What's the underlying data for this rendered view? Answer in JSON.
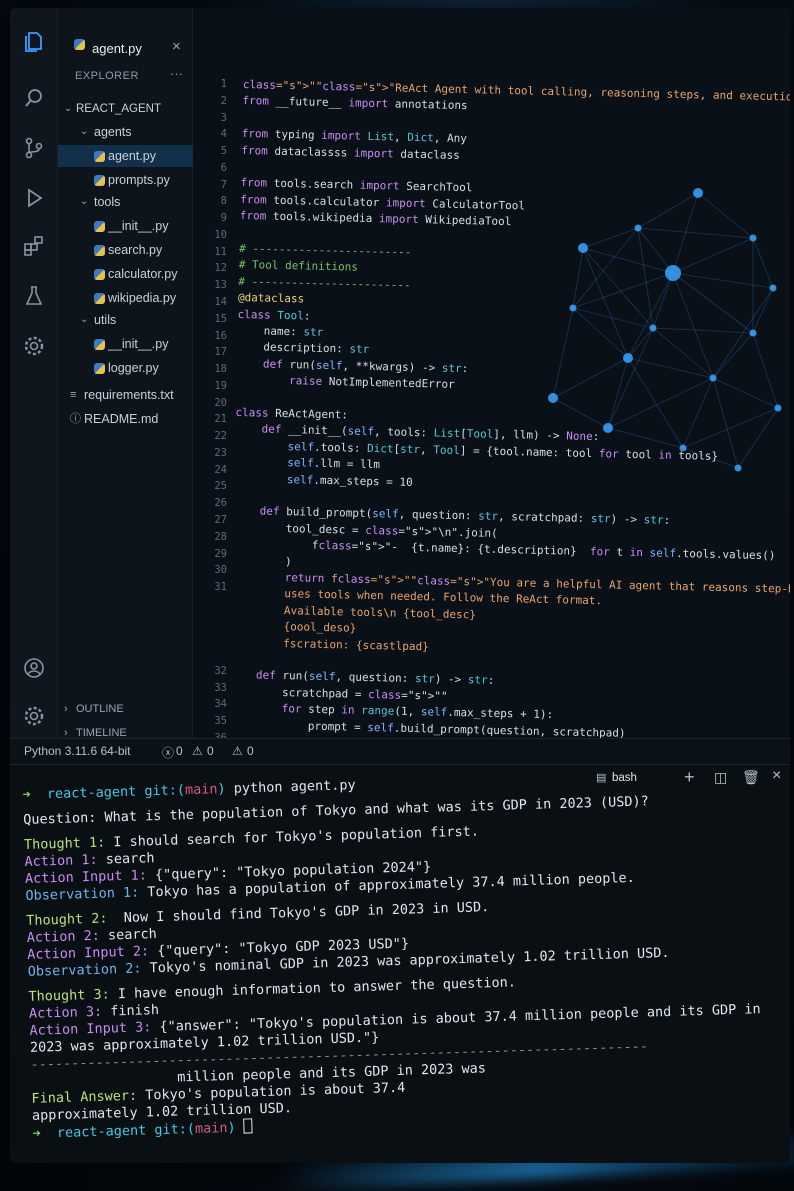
{
  "editor_tab": {
    "filename": "agent.py",
    "close_glyph": "×"
  },
  "explorer": {
    "title": "EXPLORER",
    "more": "···",
    "root": "REACT_AGENT",
    "items": [
      {
        "label": "agents",
        "type": "folder"
      },
      {
        "label": "agent.py",
        "type": "py",
        "selected": true
      },
      {
        "label": "prompts.py",
        "type": "py"
      },
      {
        "label": "tools",
        "type": "folder"
      },
      {
        "label": "__init__.py",
        "type": "py"
      },
      {
        "label": "search.py",
        "type": "py"
      },
      {
        "label": "calculator.py",
        "type": "py"
      },
      {
        "label": "wikipedia.py",
        "type": "py"
      },
      {
        "label": "utils",
        "type": "folder"
      },
      {
        "label": "__init__.py",
        "type": "py"
      },
      {
        "label": "logger.py",
        "type": "py"
      },
      {
        "label": "requirements.txt",
        "type": "txt"
      },
      {
        "label": "README.md",
        "type": "md"
      }
    ],
    "outline": "OUTLINE",
    "timeline": "TIMELINE"
  },
  "activity_icons": [
    "files-icon",
    "search-icon",
    "source-control-icon",
    "run-debug-icon",
    "extensions-icon",
    "testing-icon",
    "settings-gear-icon",
    "account-icon",
    "manage-gear-icon"
  ],
  "code": {
    "line_numbers": [
      "1",
      "2",
      "3",
      "4",
      "5",
      "6",
      "7",
      "8",
      "9",
      "10",
      "11",
      "12",
      "13",
      "14",
      "15",
      "16",
      "17",
      "18",
      "19",
      "20",
      "21",
      "22",
      "23",
      "24",
      "25",
      "26",
      "27",
      "28",
      "29",
      "30",
      "31",
      "32",
      "33",
      "34",
      "35",
      "36"
    ],
    "lines": [
      "\"\"\"ReAct Agent with tool calling, reasoning steps, and execution loop.\"\"\"",
      "from __future__ import annotations",
      "",
      "from typing import List, Dict, Any",
      "from dataclassss import dataclass",
      "",
      "from tools.search import SearchTool",
      "from tools.calculator import CalculatorTool",
      "from tools.wikipedia import WikipediaTool",
      "",
      "# ------------------------",
      "# Tool definitions",
      "# ------------------------",
      "@dataclass",
      "class Tool:",
      "    name: str",
      "    description: str",
      "    def run(self, **kwargs) -> str:",
      "        raise NotImplementedError",
      "",
      "class ReActAgent:",
      "    def __init__(self, tools: List[Tool], llm) -> None:",
      "        self.tools: Dict[str, Tool] = {tool.name: tool for tool in tools}",
      "        self.llm = llm",
      "        self.max_steps = 10",
      "",
      "    def build_prompt(self, question: str, scratchpad: str) -> str:",
      "        tool_desc = \"\\n\".join(",
      "            f\"-  {t.name}: {t.description}  for t in self.tools.values()",
      "        )",
      "        return f\"\"\"You are a helpful AI agent that reasons step-by-step and",
      "        uses tools when needed. Follow the ReAct format.",
      "        Available tools\\n {tool_desc}",
      "        {oool_deso}",
      "        fscration: {scastlрad}",
      "",
      "    def run(self, question: str) -> str:",
      "        scratchpad = \"\"",
      "        for step in range(1, self.max_steps + 1):",
      "            prompt = self.build_prompt(question, scratchpad)"
    ]
  },
  "status_bar": {
    "python": "Python  3.11.6  64-bit",
    "errors": "0",
    "warnings": "0",
    "problems": "0"
  },
  "terminal": {
    "shell_tab": "bash",
    "prompt_arrow": "➜",
    "cwd": "react-agent",
    "git_label": "git:(",
    "branch": "main",
    "git_close": ")",
    "command": "python agent.py",
    "question": "Question: What is the population of Tokyo and what was its GDP in 2023 (USD)?",
    "steps": [
      {
        "label": "Thought 1:",
        "text": " I should search for Tokyo's population first."
      },
      {
        "label": "Action 1:",
        "text": " search"
      },
      {
        "label": "Action Input 1:",
        "text": " {\"query\": \"Tokyo population 2024\"}"
      },
      {
        "label": "Observation 1:",
        "text": " Tokyo has a population of approximately 37.4 million people."
      },
      {
        "label": "Thought 2:",
        "text": "  Now I should find Tokyo's GDP in 2023 in USD."
      },
      {
        "label": "Action 2:",
        "text": " search"
      },
      {
        "label": "Action Input 2:",
        "text": " {\"query\": \"Tokyo GDP 2023 USD\"}"
      },
      {
        "label": "Observation 2:",
        "text": " Tokyo's nominal GDP in 2023 was approximately 1.02 trillion USD."
      },
      {
        "label": "Thought 3:",
        "text": " I have enough information to answer the question."
      },
      {
        "label": "Action 3:",
        "text": " finish"
      },
      {
        "label": "Action Input 3:",
        "text": " {\"answer\": \"Tokyo's population is about 37.4 million people and its GDP in"
      }
    ],
    "answer_cont_1": "2023 was approximately 1.02 trillion USD.\"}",
    "dash_line": "----------------------------------------------------------------------------",
    "answer_cont_2": "                  million people and its GDP in 2023 was",
    "final_label": "Final Answer:",
    "final_text": " Tokyo's population is about 37.4",
    "final_text_2": "approximately 1.02 trillion USD."
  },
  "colors": {
    "accent": "#7fd46a",
    "keyword": "#c98ef0",
    "string": "#e9a36b",
    "comment": "#7dbd68",
    "selection": "#12304a"
  }
}
